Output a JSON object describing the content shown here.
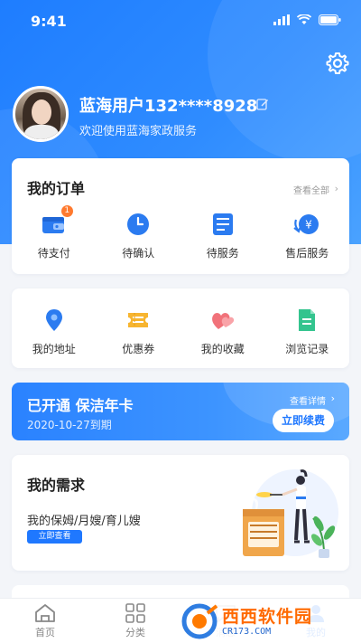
{
  "status_bar": {
    "time": "9:41"
  },
  "profile": {
    "username": "蓝海用户132****8928",
    "welcome": "欢迎使用蓝海家政服务"
  },
  "orders": {
    "title": "我的订单",
    "view_all": "查看全部",
    "items": [
      {
        "label": "待支付",
        "icon": "wallet-icon",
        "badge": "1"
      },
      {
        "label": "待确认",
        "icon": "clock-icon"
      },
      {
        "label": "待服务",
        "icon": "service-list-icon"
      },
      {
        "label": "售后服务",
        "icon": "refund-icon"
      }
    ]
  },
  "tools": {
    "items": [
      {
        "label": "我的地址",
        "icon": "location-pin-icon"
      },
      {
        "label": "优惠券",
        "icon": "coupon-icon"
      },
      {
        "label": "我的收藏",
        "icon": "heart-icon"
      },
      {
        "label": "浏览记录",
        "icon": "history-doc-icon"
      }
    ]
  },
  "membership": {
    "status": "已开通   保洁年卡",
    "expiry": "2020-10-27到期",
    "details_link": "查看详情",
    "renew_button": "立即续费"
  },
  "needs": {
    "title": "我的需求",
    "description": "我的保姆/月嫂/育儿嫂",
    "button": "立即查看",
    "illustration": "cooking-illustration"
  },
  "tab_bar": {
    "tabs": [
      {
        "label": "首页",
        "icon": "home-icon"
      },
      {
        "label": "分类",
        "icon": "grid-icon"
      },
      {
        "label": "消息",
        "icon": "message-icon"
      },
      {
        "label": "我的",
        "icon": "user-icon",
        "active": true
      }
    ]
  },
  "watermark": {
    "main": "西西软件园",
    "sub": "CR173.COM"
  },
  "colors": {
    "primary": "#1f78ff",
    "badge": "#ff7a2f",
    "background": "#f3f5f9"
  }
}
